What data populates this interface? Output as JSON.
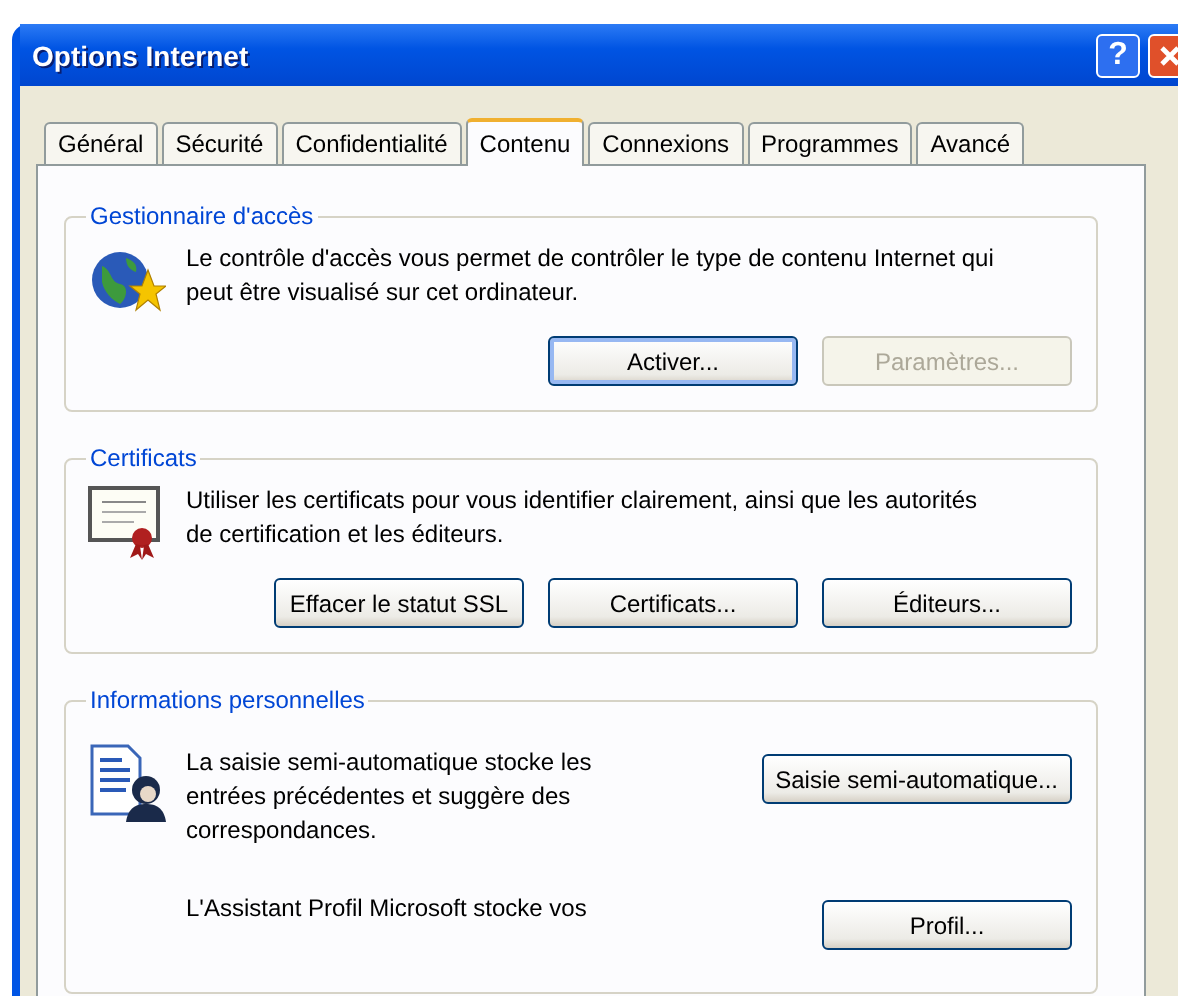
{
  "window": {
    "title": "Options Internet",
    "help_button": "?"
  },
  "tabs": [
    {
      "label": "Général",
      "selected": false
    },
    {
      "label": "Sécurité",
      "selected": false
    },
    {
      "label": "Confidentialité",
      "selected": false
    },
    {
      "label": "Contenu",
      "selected": true
    },
    {
      "label": "Connexions",
      "selected": false
    },
    {
      "label": "Programmes",
      "selected": false
    },
    {
      "label": "Avancé",
      "selected": false
    }
  ],
  "groups": [
    {
      "legend": "Gestionnaire d'accès",
      "sections": [
        {
          "kind": "stacked",
          "text": "Le contrôle d'accès vous permet de contrôler le type de contenu Internet qui peut être visualisé sur cet ordinateur.",
          "buttons": [
            {
              "label": "Activer...",
              "default": true,
              "disabled": false
            },
            {
              "label": "Paramètres...",
              "default": false,
              "disabled": true
            }
          ]
        }
      ]
    },
    {
      "legend": "Certificats",
      "sections": [
        {
          "kind": "stacked",
          "text": "Utiliser les certificats pour vous identifier clairement, ainsi que les autorités de certification et les éditeurs.",
          "buttons": [
            {
              "label": "Effacer le statut SSL",
              "default": false,
              "disabled": false
            },
            {
              "label": "Certificats...",
              "default": false,
              "disabled": false
            },
            {
              "label": "Éditeurs...",
              "default": false,
              "disabled": false
            }
          ]
        }
      ]
    },
    {
      "legend": "Informations personnelles",
      "sections": [
        {
          "kind": "inline",
          "text": "La saisie semi-automatique stocke les entrées précédentes et suggère des correspondances.",
          "buttons": [
            {
              "label": "Saisie semi-automatique...",
              "default": false,
              "disabled": false
            }
          ]
        },
        {
          "kind": "inline",
          "text": "L'Assistant Profil Microsoft stocke vos",
          "buttons": [
            {
              "label": "Profil...",
              "default": false,
              "disabled": false
            }
          ]
        }
      ]
    }
  ]
}
